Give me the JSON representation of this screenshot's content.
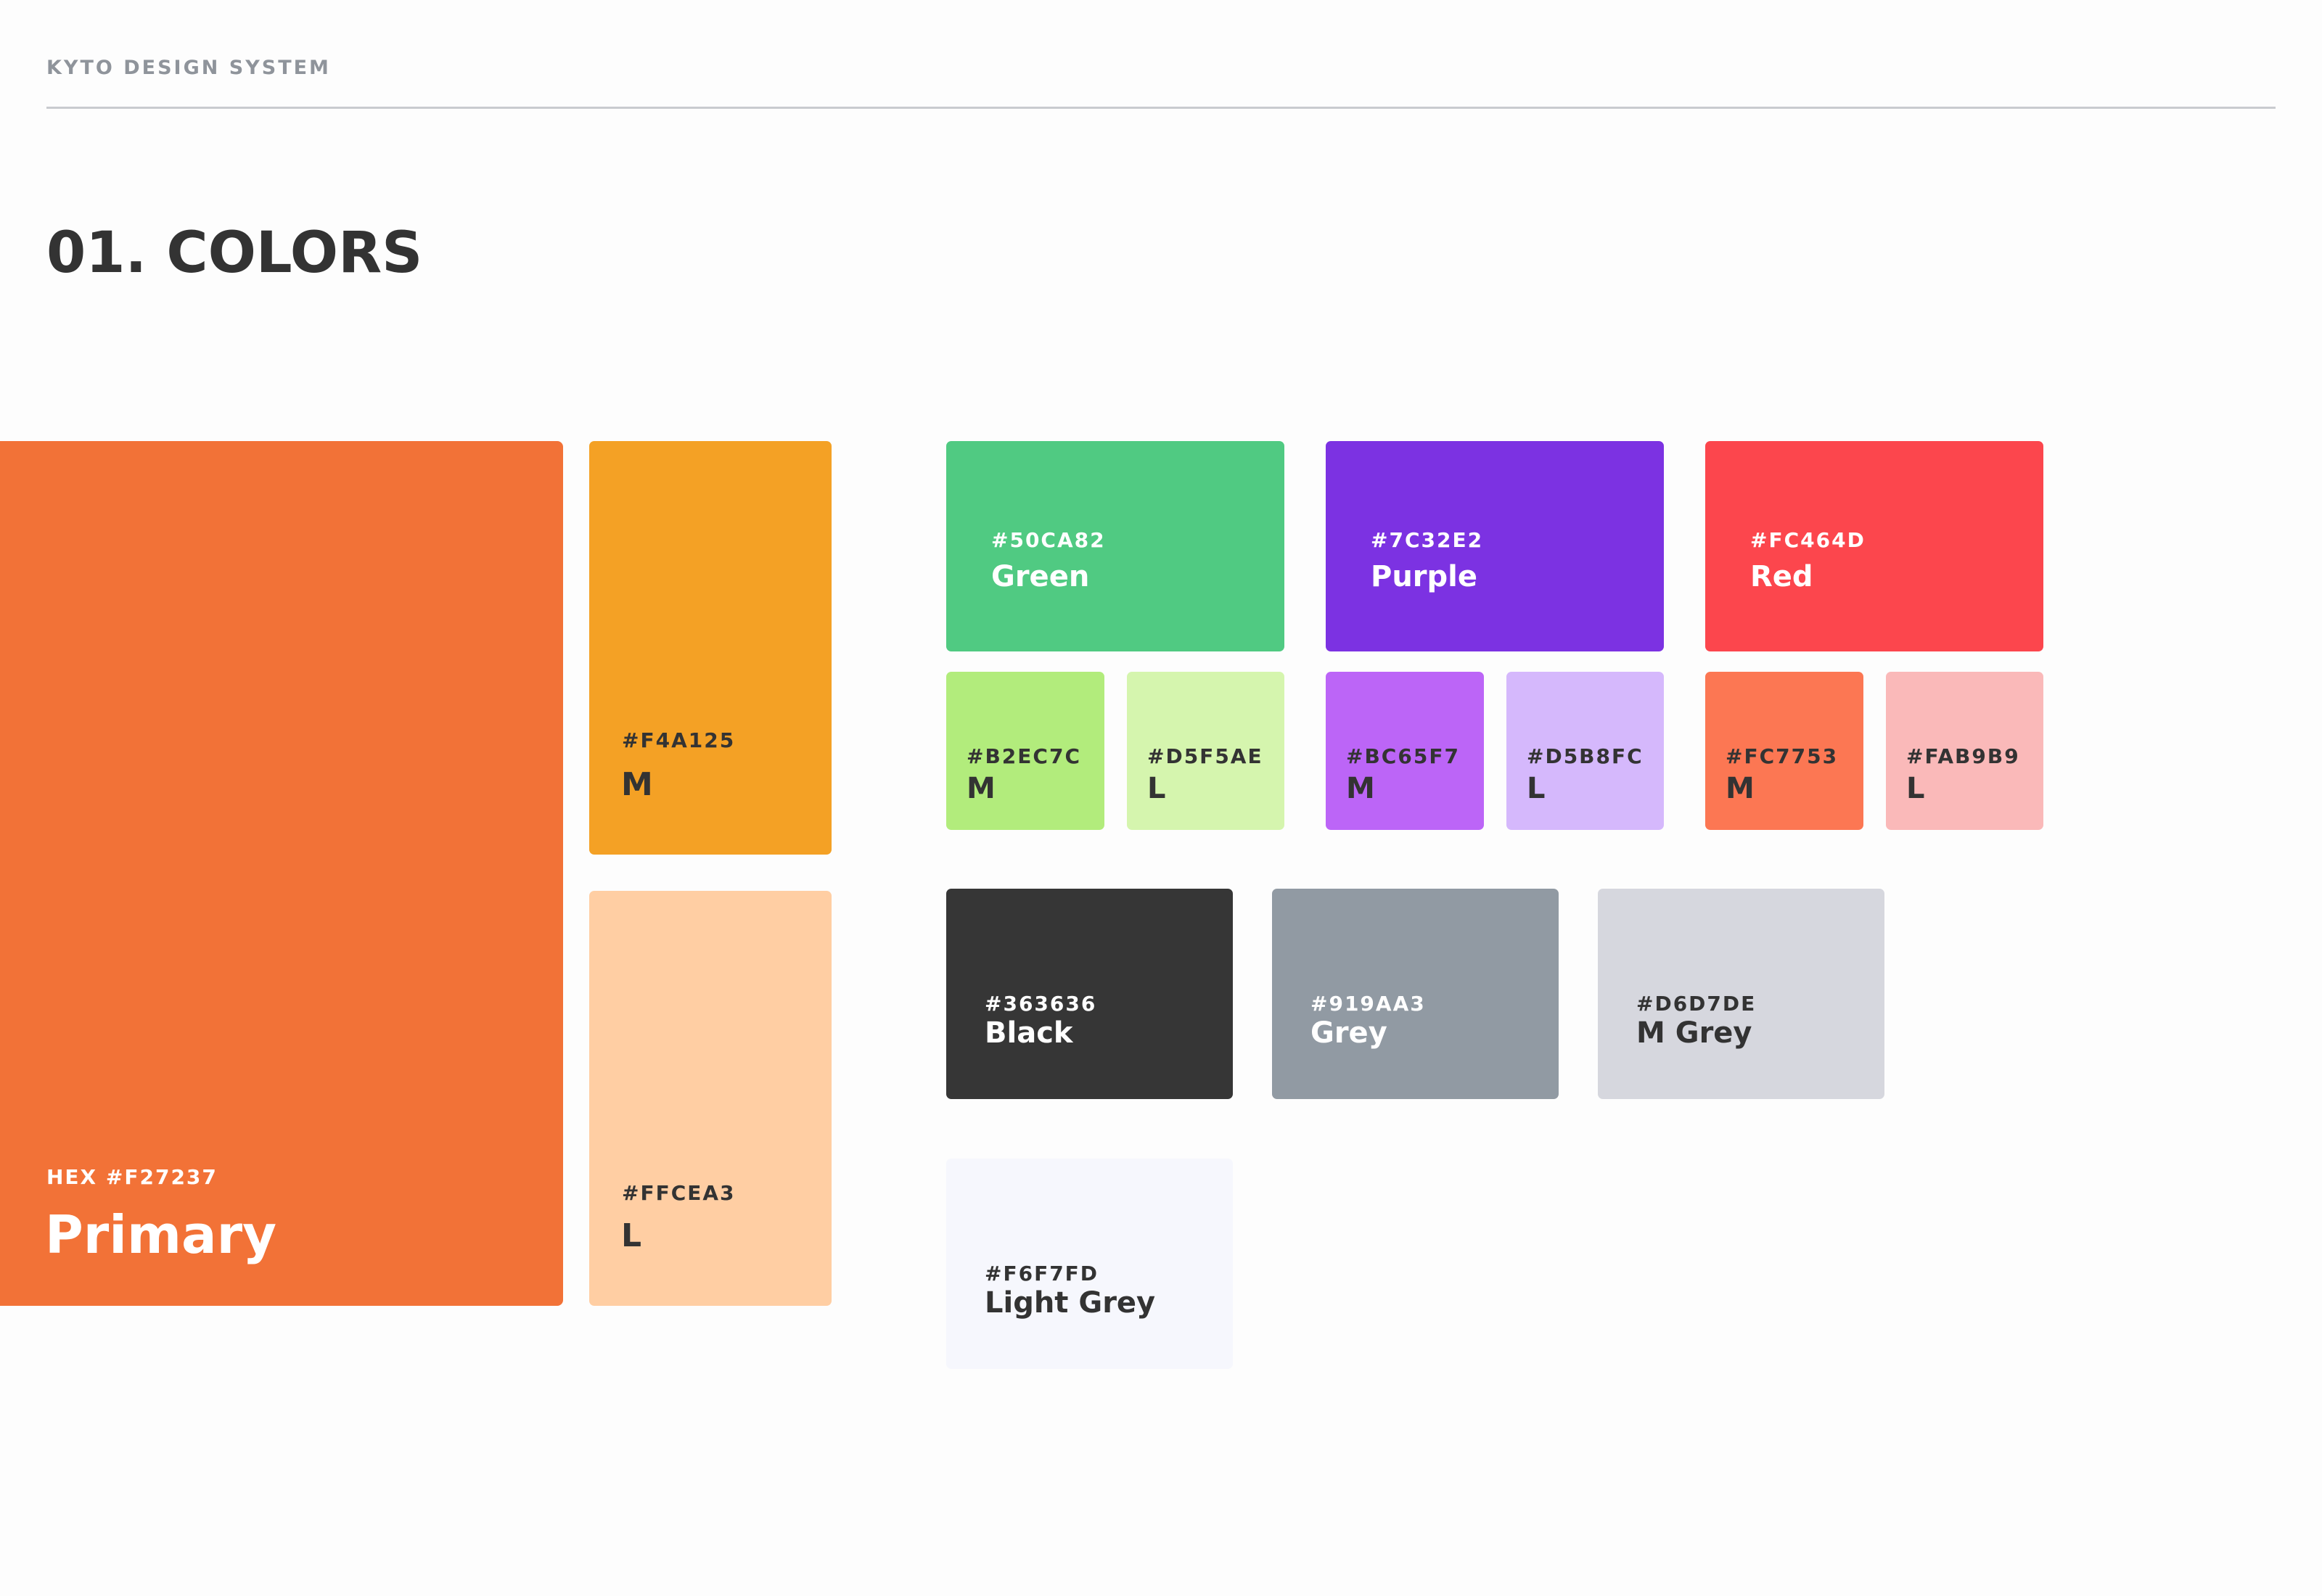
{
  "header": {
    "system_name": "KYTO DESIGN SYSTEM"
  },
  "section": {
    "title": "01. COLORS"
  },
  "primary": {
    "main": {
      "hex": "HEX #F27237",
      "name": "Primary",
      "color": "#F27237"
    },
    "medium": {
      "hex": "#F4A125",
      "name": "M",
      "color": "#F4A125"
    },
    "light": {
      "hex": "#FFCEA3",
      "name": "L",
      "color": "#FFCEA3"
    }
  },
  "green": {
    "main": {
      "hex": "#50CA82",
      "name": "Green",
      "color": "#50CA82"
    },
    "medium": {
      "hex": "#B2EC7C",
      "name": "M",
      "color": "#B2EC7C"
    },
    "light": {
      "hex": "#D5F5AE",
      "name": "L",
      "color": "#D5F5AE"
    }
  },
  "purple": {
    "main": {
      "hex": "#7C32E2",
      "name": "Purple",
      "color": "#7C32E2"
    },
    "medium": {
      "hex": "#BC65F7",
      "name": "M",
      "color": "#BC65F7"
    },
    "light": {
      "hex": "#D5B8FC",
      "name": "L",
      "color": "#D5B8FC"
    }
  },
  "red": {
    "main": {
      "hex": "#FC464D",
      "name": "Red",
      "color": "#FC464D"
    },
    "medium": {
      "hex": "#FC7753",
      "name": "M",
      "color": "#FC7753"
    },
    "light": {
      "hex": "#FAB9B9",
      "name": "L",
      "color": "#FAB9B9"
    }
  },
  "neutrals": {
    "black": {
      "hex": "#363636",
      "name": "Black",
      "color": "#363636"
    },
    "grey": {
      "hex": "#919AA3",
      "name": "Grey",
      "color": "#919AA3"
    },
    "m_grey": {
      "hex": "#D6D7DE",
      "name": "M Grey",
      "color": "#D6D7DE"
    },
    "light_grey": {
      "hex": "#F6F7FD",
      "name": "Light Grey",
      "color": "#F6F7FD"
    }
  }
}
